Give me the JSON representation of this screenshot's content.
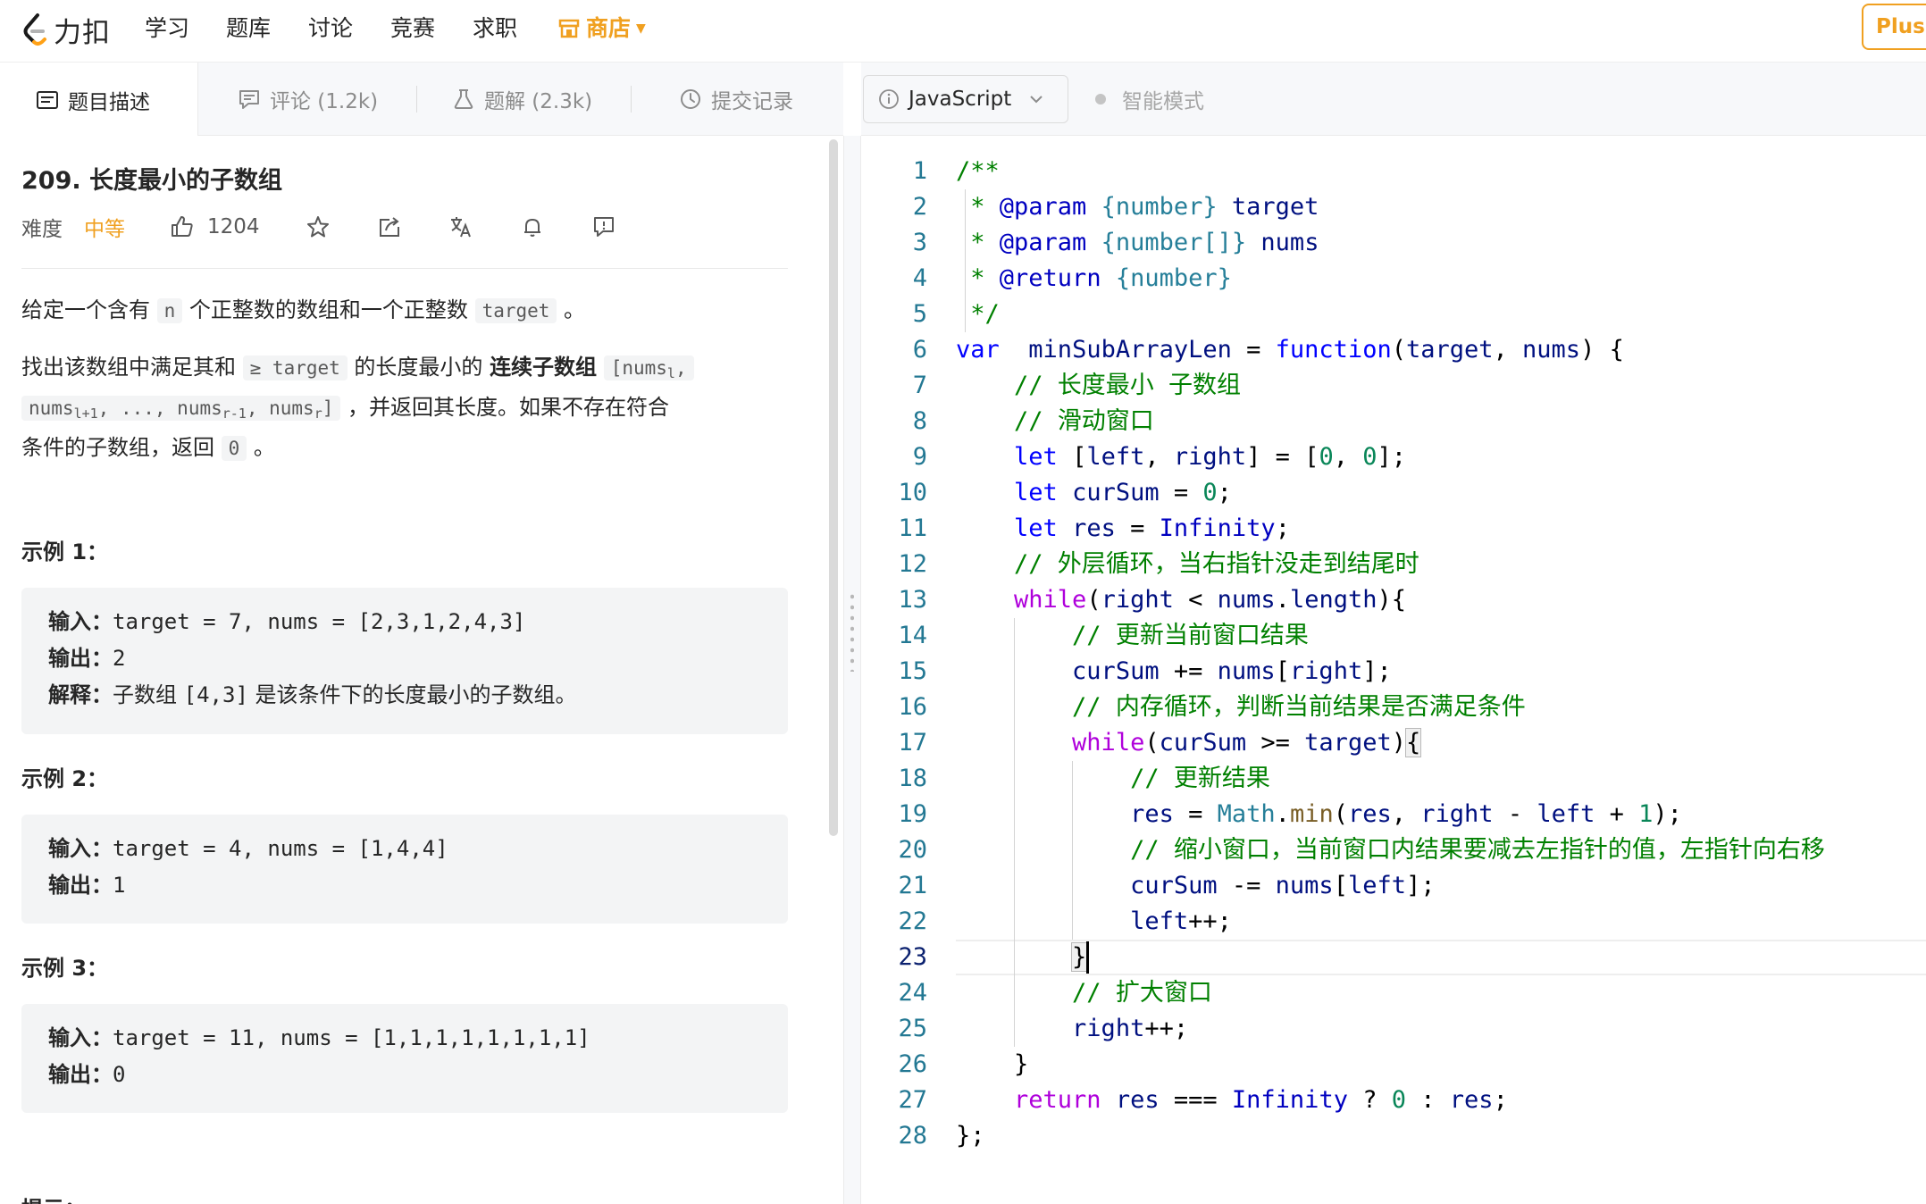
{
  "nav": {
    "logo_text": "力扣",
    "items": [
      "学习",
      "题库",
      "讨论",
      "竞赛",
      "求职"
    ],
    "store": "商店",
    "plus": "Plus 会"
  },
  "tabs": {
    "description": "题目描述",
    "comments": "评论 (1.2k)",
    "solutions": "题解 (2.3k)",
    "submissions": "提交记录"
  },
  "editor_bar": {
    "language": "JavaScript",
    "smart_mode": "智能模式"
  },
  "problem": {
    "title": "209. 长度最小的子数组",
    "difficulty_label": "难度",
    "difficulty": "中等",
    "likes": "1204",
    "desc1": {
      "a": "给定一个含有 ",
      "code_n": "n",
      "b": " 个正整数的数组和一个正整数 ",
      "code_target": "target",
      "c": " 。"
    },
    "desc2": {
      "a": "找出该数组中满足其和 ",
      "code_ge_target": "≥ target",
      "b": " 的长度最小的 ",
      "bold": "连续子数组",
      "code1_a": "[nums",
      "code1_sub": "l",
      "code1_b": ",",
      "code2_a": "nums",
      "code2_sub1": "l+1",
      "code2_b": ", ..., nums",
      "code2_sub2": "r-1",
      "code2_c": ", nums",
      "code2_sub3": "r",
      "code2_d": "]",
      "c": " ，并返回其长度。如果不存在符合",
      "d": "条件的子数组，返回 ",
      "code_0": "0",
      "e": " 。"
    },
    "examples": [
      {
        "label": "示例 1：",
        "input_label": "输入：",
        "input": "target = 7, nums = [2,3,1,2,4,3]",
        "output_label": "输出：",
        "output": "2",
        "explain_label": "解释：",
        "explain_a": "子数组 ",
        "explain_code": "[4,3]",
        "explain_b": " 是该条件下的长度最小的子数组。"
      },
      {
        "label": "示例 2：",
        "input_label": "输入：",
        "input": "target = 4, nums = [1,4,4]",
        "output_label": "输出：",
        "output": "1"
      },
      {
        "label": "示例 3：",
        "input_label": "输入：",
        "input": "target = 11, nums = [1,1,1,1,1,1,1,1]",
        "output_label": "输出：",
        "output": "0"
      }
    ],
    "next_heading_partial": "提示："
  },
  "code": {
    "current_line": 23,
    "lines": [
      [
        [
          "cm",
          "/**"
        ]
      ],
      [
        [
          "cm",
          " * "
        ],
        [
          "dk",
          "@param"
        ],
        [
          "cm",
          " "
        ],
        [
          "ty",
          "{number}"
        ],
        [
          "cm",
          " "
        ],
        [
          "va",
          "target"
        ]
      ],
      [
        [
          "cm",
          " * "
        ],
        [
          "dk",
          "@param"
        ],
        [
          "cm",
          " "
        ],
        [
          "ty",
          "{number[]}"
        ],
        [
          "cm",
          " "
        ],
        [
          "va",
          "nums"
        ]
      ],
      [
        [
          "cm",
          " * "
        ],
        [
          "dk",
          "@return"
        ],
        [
          "cm",
          " "
        ],
        [
          "ty",
          "{number}"
        ]
      ],
      [
        [
          "cm",
          " */"
        ]
      ],
      [
        [
          "kw",
          "var"
        ],
        [
          "",
          "  "
        ],
        [
          "va",
          "minSubArrayLen"
        ],
        [
          "",
          " = "
        ],
        [
          "kw",
          "function"
        ],
        [
          "",
          "("
        ],
        [
          "va",
          "target"
        ],
        [
          "",
          ", "
        ],
        [
          "va",
          "nums"
        ],
        [
          "",
          ") {"
        ]
      ],
      [
        [
          "",
          "    "
        ],
        [
          "cm",
          "// 长度最小 子数组"
        ]
      ],
      [
        [
          "",
          "    "
        ],
        [
          "cm",
          "// 滑动窗口"
        ]
      ],
      [
        [
          "",
          "    "
        ],
        [
          "kw",
          "let"
        ],
        [
          "",
          " ["
        ],
        [
          "va",
          "left"
        ],
        [
          "",
          ", "
        ],
        [
          "va",
          "right"
        ],
        [
          "",
          "] = ["
        ],
        [
          "num",
          "0"
        ],
        [
          "",
          ", "
        ],
        [
          "num",
          "0"
        ],
        [
          "",
          "];"
        ]
      ],
      [
        [
          "",
          "    "
        ],
        [
          "kw",
          "let"
        ],
        [
          "",
          " "
        ],
        [
          "va",
          "curSum"
        ],
        [
          "",
          " = "
        ],
        [
          "num",
          "0"
        ],
        [
          "",
          ";"
        ]
      ],
      [
        [
          "",
          "    "
        ],
        [
          "kw",
          "let"
        ],
        [
          "",
          " "
        ],
        [
          "va",
          "res"
        ],
        [
          "",
          " = "
        ],
        [
          "dk",
          "Infinity"
        ],
        [
          "",
          ";"
        ]
      ],
      [
        [
          "",
          "    "
        ],
        [
          "cm",
          "// 外层循环，当右指针没走到结尾时"
        ]
      ],
      [
        [
          "",
          "    "
        ],
        [
          "ctl",
          "while"
        ],
        [
          "",
          "("
        ],
        [
          "va",
          "right"
        ],
        [
          "",
          " < "
        ],
        [
          "va",
          "nums"
        ],
        [
          "",
          "."
        ],
        [
          "va",
          "length"
        ],
        [
          "",
          "){"
        ]
      ],
      [
        [
          "",
          "        "
        ],
        [
          "cm",
          "// 更新当前窗口结果"
        ]
      ],
      [
        [
          "",
          "        "
        ],
        [
          "va",
          "curSum"
        ],
        [
          "",
          " += "
        ],
        [
          "va",
          "nums"
        ],
        [
          "",
          "["
        ],
        [
          "va",
          "right"
        ],
        [
          "",
          "];"
        ]
      ],
      [
        [
          "",
          "        "
        ],
        [
          "cm",
          "// 内存循环，判断当前结果是否满足条件"
        ]
      ],
      [
        [
          "",
          "        "
        ],
        [
          "ctl",
          "while"
        ],
        [
          "",
          "("
        ],
        [
          "va",
          "curSum"
        ],
        [
          "",
          " >= "
        ],
        [
          "va",
          "target"
        ],
        [
          "",
          ")"
        ],
        [
          "br",
          "{"
        ]
      ],
      [
        [
          "",
          "            "
        ],
        [
          "cm",
          "// 更新结果"
        ]
      ],
      [
        [
          "",
          "            "
        ],
        [
          "va",
          "res"
        ],
        [
          "",
          " = "
        ],
        [
          "ty",
          "Math"
        ],
        [
          "",
          "."
        ],
        [
          "fn",
          "min"
        ],
        [
          "",
          "("
        ],
        [
          "va",
          "res"
        ],
        [
          "",
          ", "
        ],
        [
          "va",
          "right"
        ],
        [
          "",
          " - "
        ],
        [
          "va",
          "left"
        ],
        [
          "",
          " + "
        ],
        [
          "num",
          "1"
        ],
        [
          "",
          ");"
        ]
      ],
      [
        [
          "",
          "            "
        ],
        [
          "cm",
          "// 缩小窗口，当前窗口内结果要减去左指针的值，左指针向右移"
        ]
      ],
      [
        [
          "",
          "            "
        ],
        [
          "va",
          "curSum"
        ],
        [
          "",
          " -= "
        ],
        [
          "va",
          "nums"
        ],
        [
          "",
          "["
        ],
        [
          "va",
          "left"
        ],
        [
          "",
          "];"
        ]
      ],
      [
        [
          "",
          "            "
        ],
        [
          "va",
          "left"
        ],
        [
          "",
          "++;"
        ]
      ],
      [
        [
          "",
          "        "
        ],
        [
          "br",
          "}"
        ]
      ],
      [
        [
          "",
          "        "
        ],
        [
          "cm",
          "// 扩大窗口"
        ]
      ],
      [
        [
          "",
          "        "
        ],
        [
          "va",
          "right"
        ],
        [
          "",
          "++;"
        ]
      ],
      [
        [
          "",
          "    }"
        ]
      ],
      [
        [
          "",
          "    "
        ],
        [
          "ctl",
          "return"
        ],
        [
          "",
          " "
        ],
        [
          "va",
          "res"
        ],
        [
          "",
          " === "
        ],
        [
          "dk",
          "Infinity"
        ],
        [
          "",
          " ? "
        ],
        [
          "num",
          "0"
        ],
        [
          "",
          " : "
        ],
        [
          "va",
          "res"
        ],
        [
          "",
          ";"
        ]
      ],
      [
        [
          "",
          "};"
        ]
      ]
    ]
  }
}
